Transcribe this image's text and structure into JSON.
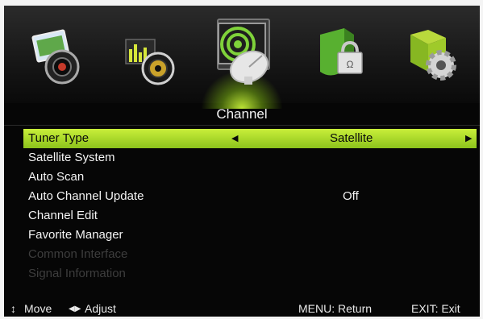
{
  "menu": {
    "title": "Channel",
    "tabs": [
      {
        "name": "picture-icon"
      },
      {
        "name": "sound-icon"
      },
      {
        "name": "channel-icon"
      },
      {
        "name": "lock-icon"
      },
      {
        "name": "setup-icon"
      }
    ],
    "items": [
      {
        "label": "Tuner Type",
        "value": "Satellite",
        "selected": true
      },
      {
        "label": "Satellite System",
        "value": ""
      },
      {
        "label": "Auto Scan",
        "value": ""
      },
      {
        "label": "Auto Channel Update",
        "value": "Off"
      },
      {
        "label": "Channel Edit",
        "value": ""
      },
      {
        "label": "Favorite Manager",
        "value": ""
      },
      {
        "label": "Common Interface",
        "value": "",
        "disabled": true
      },
      {
        "label": "Signal Information",
        "value": "",
        "disabled": true
      }
    ]
  },
  "footer": {
    "move_label": "Move",
    "adjust_label": "Adjust",
    "menu_label": "MENU: Return",
    "exit_label": "EXIT: Exit"
  },
  "colors": {
    "selection": "#b8e330",
    "background": "#060606",
    "disabled_text": "#3d3d3d"
  }
}
